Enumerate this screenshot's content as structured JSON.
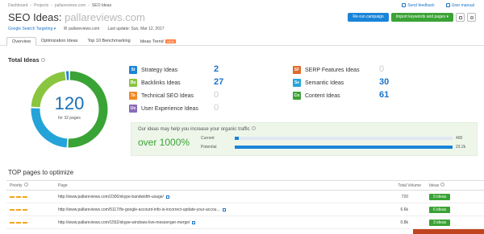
{
  "breadcrumb": [
    "Dashboard",
    "Projects",
    "pallareviews.com",
    "SEO Ideas"
  ],
  "top_links": {
    "feedback": "Send feedback",
    "manual": "User manual"
  },
  "title": {
    "prefix": "SEO Ideas: ",
    "domain": "pallareviews.com"
  },
  "buttons": {
    "rerun": "Re-run campaign",
    "import": "Import keywords and pages ▾"
  },
  "meta": {
    "targeting": "Google Search Targeting ▾",
    "site": "pallareviews.com",
    "last_update": "Last update: Sun, Mar 12, 2017"
  },
  "tabs": [
    "Overview",
    "Optimization Ideas",
    "Top 10 Benchmarking",
    "Ideas Trend"
  ],
  "tab_new": "NEW",
  "total": {
    "title": "Total Ideas",
    "value": "120",
    "sub": "for 32 pages"
  },
  "ideas": [
    {
      "badge": "St",
      "label": "Strategy Ideas",
      "value": "2",
      "color": "#1a84d8"
    },
    {
      "badge": "Ba",
      "label": "Backlinks Ideas",
      "value": "27",
      "color": "#8ac53f"
    },
    {
      "badge": "Te",
      "label": "Technical SEO Ideas",
      "value": "0",
      "color": "#f08a24"
    },
    {
      "badge": "Ux",
      "label": "User Experience Ideas",
      "value": "0",
      "color": "#8a6bb8"
    },
    {
      "badge": "SF",
      "label": "SERP Features Ideas",
      "value": "0",
      "color": "#e06a2b"
    },
    {
      "badge": "Se",
      "label": "Semantic Ideas",
      "value": "30",
      "color": "#24a3d8"
    },
    {
      "badge": "Co",
      "label": "Content Ideas",
      "value": "61",
      "color": "#3aa335"
    }
  ],
  "traffic": {
    "label": "Our ideas may help you increase your organic traffic",
    "big": "over 1000%",
    "current_label": "Current",
    "current_value": "400",
    "potential_label": "Potential",
    "potential_value": "23.2k",
    "current_fraction": 0.02,
    "potential_fraction": 1.0
  },
  "top_pages": {
    "title": "TOP pages to optimize",
    "columns": [
      "Priority",
      "Page",
      "Total Volume",
      "Ideas"
    ],
    "rows": [
      {
        "page": "http://www.pallareviews.com/2300/skype-bandwidth-usage/",
        "volume": "720",
        "ideas": "9 ideas"
      },
      {
        "page": "http://www.pallareviews.com/5117/fix-google-account-info-is-incorrect-update-your-accou...",
        "volume": "6.6k",
        "ideas": "6 ideas"
      },
      {
        "page": "http://www.pallareviews.com/1552/skype-windows-live-messenger-merge/",
        "volume": "0.8k",
        "ideas": "3 ideas"
      }
    ]
  },
  "donut_segments": [
    {
      "name": "Content",
      "value": 61,
      "color": "#3aa335"
    },
    {
      "name": "Semantic",
      "value": 30,
      "color": "#24a3d8"
    },
    {
      "name": "Backlinks",
      "value": 27,
      "color": "#8ac53f"
    },
    {
      "name": "Strategy",
      "value": 2,
      "color": "#1a84d8"
    }
  ]
}
